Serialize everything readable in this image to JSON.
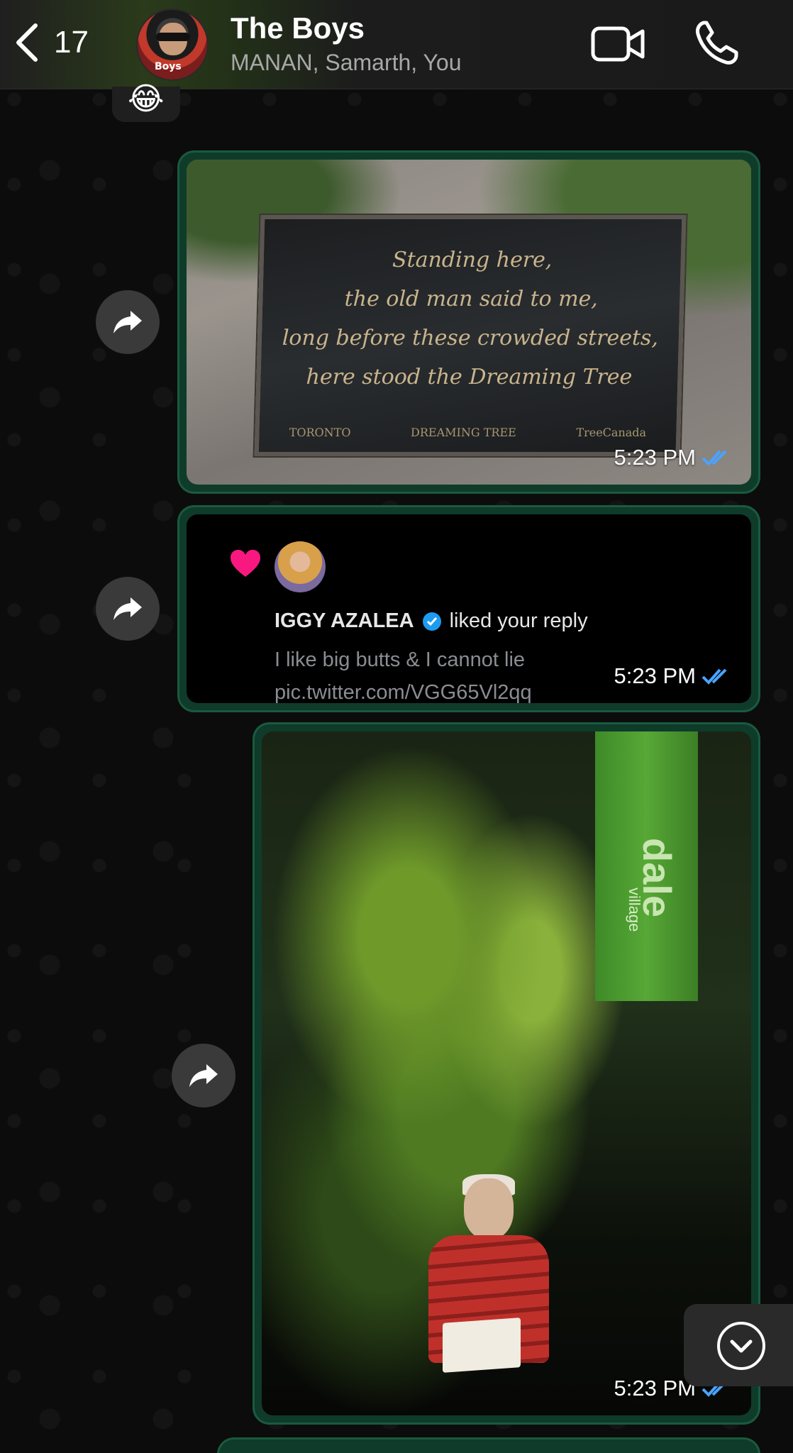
{
  "header": {
    "back_count": "17",
    "group_name": "The Boys",
    "participants": "MANAN, Samarth, You",
    "avatar_label": "Boys"
  },
  "previous_message": {
    "emoji": "😂"
  },
  "messages": [
    {
      "type": "image",
      "description": "plaque",
      "plaque_lines": [
        "Standing here,",
        "the old man said to me,",
        "long before these crowded streets,",
        "here stood the Dreaming Tree"
      ],
      "plaque_footer": [
        "TORONTO",
        "DREAMING TREE",
        "TreeCanada"
      ],
      "time": "5:23 PM",
      "status": "read"
    },
    {
      "type": "tweet-notification",
      "author": "IGGY AZALEA",
      "action": "liked your reply",
      "body": "I like big butts & I cannot lie pic.twitter.com/VGG65Vl2qq",
      "time": "5:23 PM",
      "status": "read"
    },
    {
      "type": "image",
      "banner_text": "dale",
      "banner_sub": "village",
      "time": "5:23 PM",
      "status": "read"
    }
  ],
  "colors": {
    "bubble_outgoing": "#0f3b2a",
    "bubble_border": "#1a5a3f",
    "read_tick": "#4aa3ff",
    "heart": "#f91880",
    "verified": "#1d9bf0"
  }
}
